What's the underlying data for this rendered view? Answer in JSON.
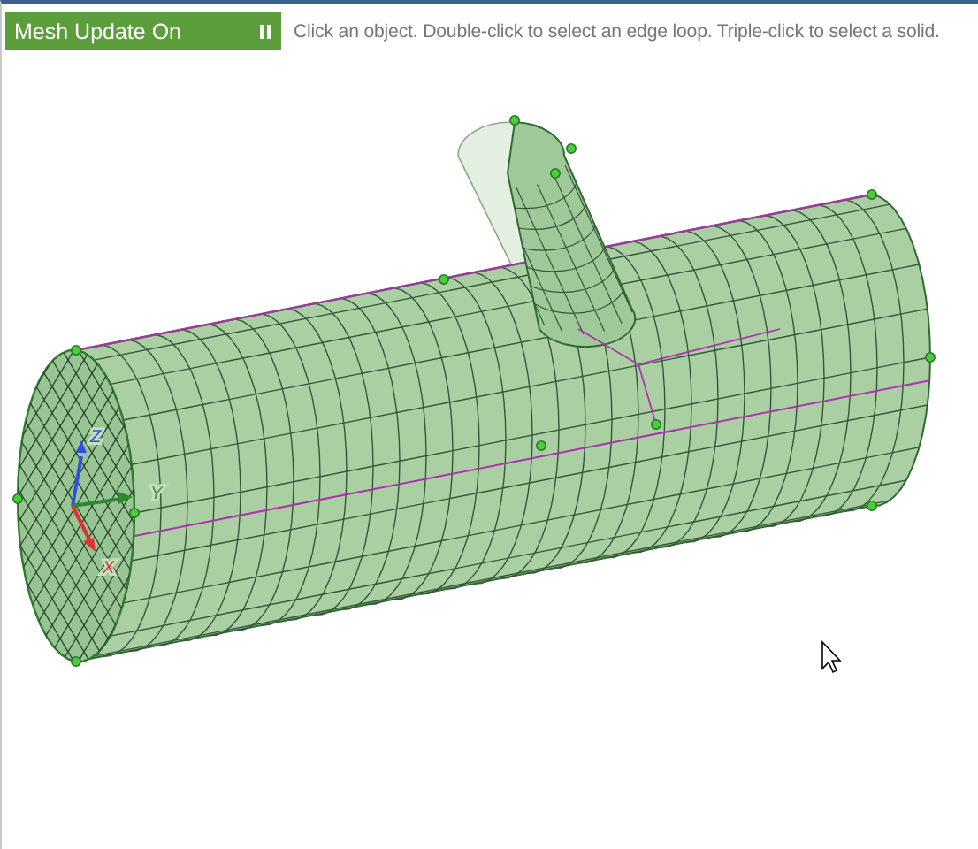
{
  "status_toggle": {
    "label": "Mesh Update On",
    "on": true
  },
  "hint": "Click an object. Double-click to select an edge loop. Triple-click to select a solid.",
  "axes": [
    {
      "label": "Z"
    },
    {
      "label": "Y"
    },
    {
      "label": "X"
    }
  ]
}
